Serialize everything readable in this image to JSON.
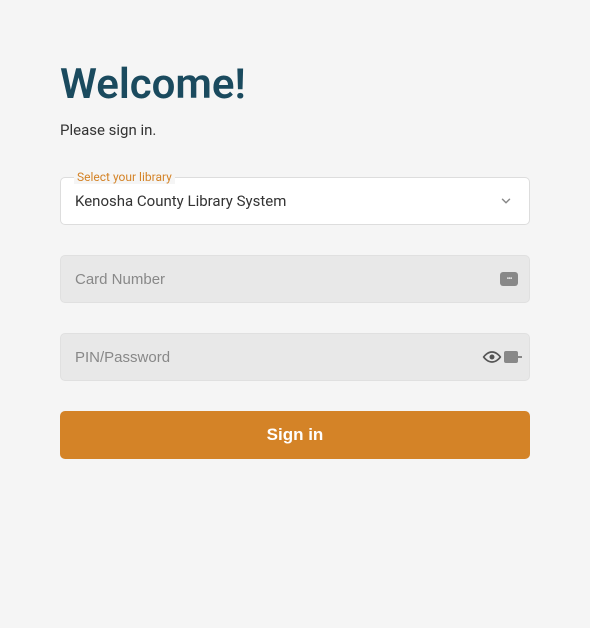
{
  "heading": "Welcome!",
  "subheading": "Please sign in.",
  "library_select": {
    "label": "Select your library",
    "value": "Kenosha County Library System"
  },
  "card_number": {
    "placeholder": "Card Number",
    "value": ""
  },
  "pin": {
    "placeholder": "PIN/Password",
    "value": ""
  },
  "signin_label": "Sign in",
  "colors": {
    "accent": "#d48327",
    "heading": "#1a4a5e"
  }
}
